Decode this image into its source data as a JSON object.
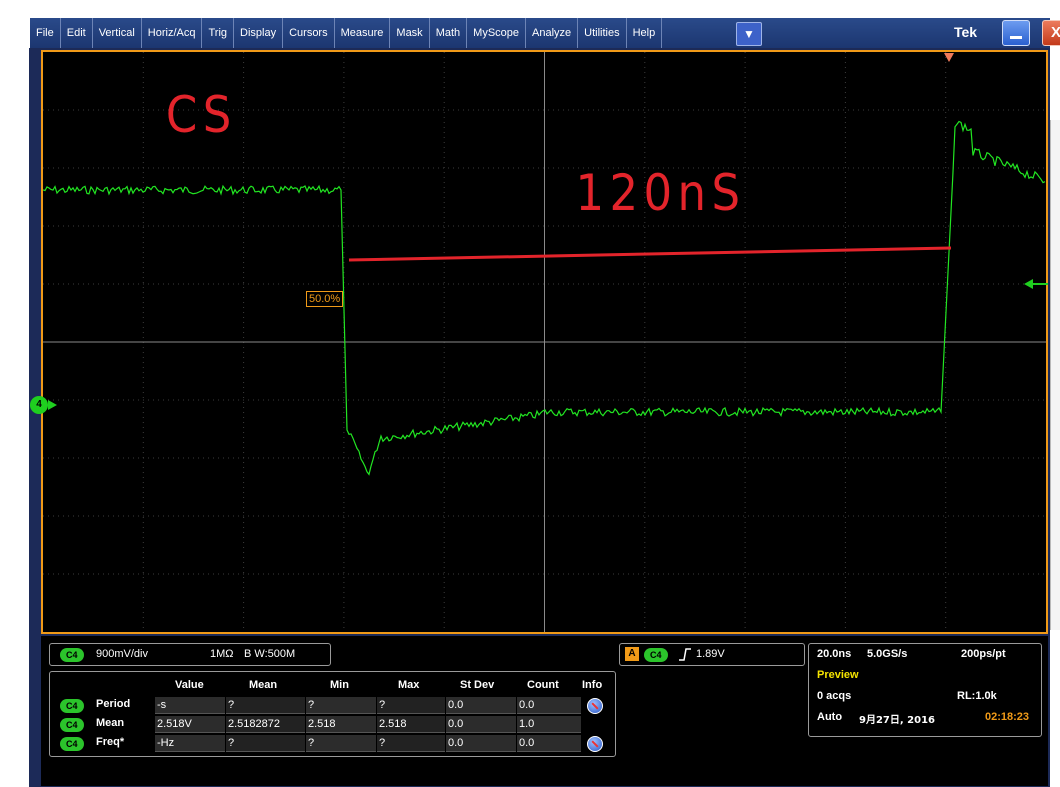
{
  "menu": {
    "items": [
      "File",
      "Edit",
      "Vertical",
      "Horiz/Acq",
      "Trig",
      "Display",
      "Cursors",
      "Measure",
      "Mask",
      "Math",
      "MyScope",
      "Analyze",
      "Utilities",
      "Help"
    ],
    "brand": "Tek"
  },
  "scope": {
    "trigger_percent_label": "50.0%",
    "channel_marker": "4"
  },
  "annotations": {
    "signal_name": "CS",
    "duration": "120nS"
  },
  "channel": {
    "badge": "C4",
    "scale": "900mV/div",
    "impedance": "1MΩ",
    "bandwidth": "B W:500M"
  },
  "trigger": {
    "badge": "C4",
    "level": "1.89V",
    "mode_icon": "rising-edge-icon"
  },
  "acquisition": {
    "timebase": "20.0ns",
    "sample_rate": "5.0GS/s",
    "resolution": "200ps/pt",
    "mode": "Preview",
    "acqs": "0 acqs",
    "record_length": "RL:1.0k",
    "trigger_mode": "Auto",
    "date": "9月27日, 2016",
    "time": "02:18:23",
    "time_color": "#f09a18",
    "mode_color": "#f5e400"
  },
  "measurements": {
    "headers": [
      "Value",
      "Mean",
      "Min",
      "Max",
      "St Dev",
      "Count",
      "Info"
    ],
    "rows": [
      {
        "badge": "C4",
        "name": "Period",
        "value": "-s",
        "mean": "?",
        "min": "?",
        "max": "?",
        "stdev": "0.0",
        "count": "0.0",
        "info": true
      },
      {
        "badge": "C4",
        "name": "Mean",
        "value": "2.518V",
        "mean": "2.5182872",
        "min": "2.518",
        "max": "2.518",
        "stdev": "0.0",
        "count": "1.0",
        "info": false
      },
      {
        "badge": "C4",
        "name": "Freq*",
        "value": "-Hz",
        "mean": "?",
        "min": "?",
        "max": "?",
        "stdev": "0.0",
        "count": "0.0",
        "info": true
      }
    ]
  },
  "colors": {
    "trace": "#22e622",
    "annotation": "#e3242b",
    "graticule_border": "#f09a18"
  }
}
